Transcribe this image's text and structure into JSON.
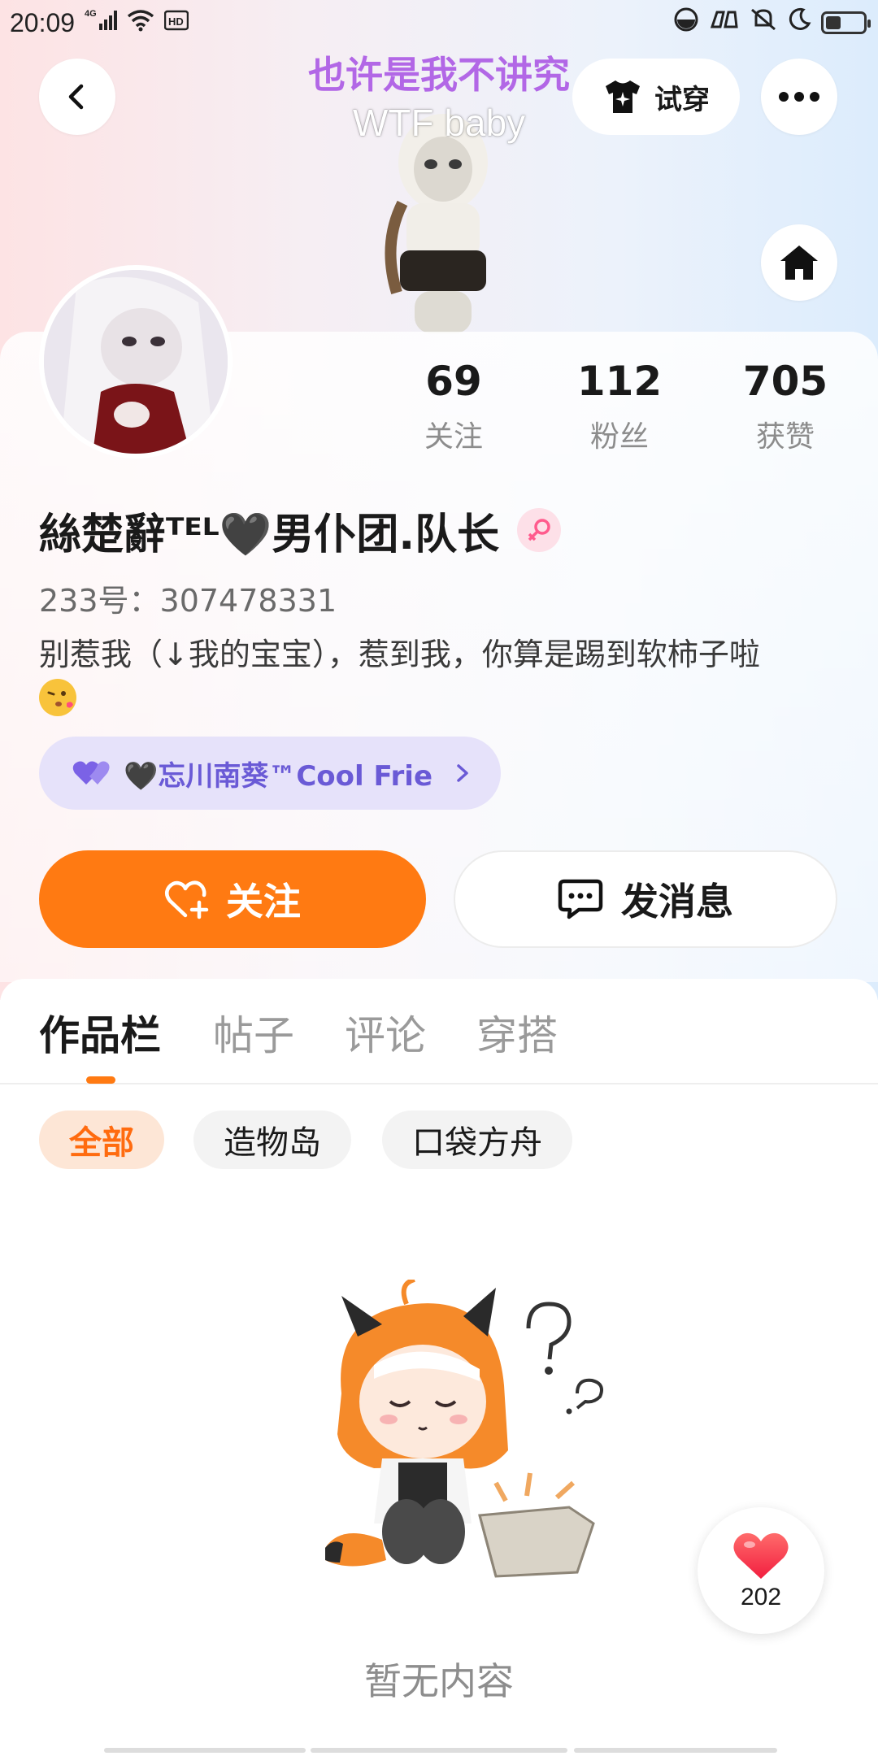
{
  "status_bar": {
    "time": "20:09",
    "network": "4G",
    "hd": "HD",
    "battery_level": 0.4
  },
  "header": {
    "song_title": "也许是我不讲究",
    "song_artist": "WTF baby",
    "tryon_label": "试穿"
  },
  "stats": [
    {
      "value": "69",
      "label": "关注"
    },
    {
      "value": "112",
      "label": "粉丝"
    },
    {
      "value": "705",
      "label": "获赞"
    }
  ],
  "profile": {
    "nickname": "絲楚辭ᵀᴱᴸ🖤男仆团.队长",
    "gender": "female",
    "uid": "233号：307478331",
    "bio": "别惹我（↓我的宝宝），惹到我，你算是踢到软柿子啦"
  },
  "group": {
    "label": "🖤忘川南葵™Cool Frie"
  },
  "actions": {
    "follow_label": "关注",
    "message_label": "发消息"
  },
  "tabs": [
    "作品栏",
    "帖子",
    "评论",
    "穿搭"
  ],
  "active_tab": "作品栏",
  "filters": [
    "全部",
    "造物岛",
    "口袋方舟"
  ],
  "active_filter": "全部",
  "empty": {
    "text": "暂无内容"
  },
  "like_float": {
    "count": "202"
  },
  "colors": {
    "accent": "#ff7a12",
    "group_text": "#6a5ad6",
    "group_bg": "#e6e2fa",
    "song_title": "#b267e6"
  }
}
